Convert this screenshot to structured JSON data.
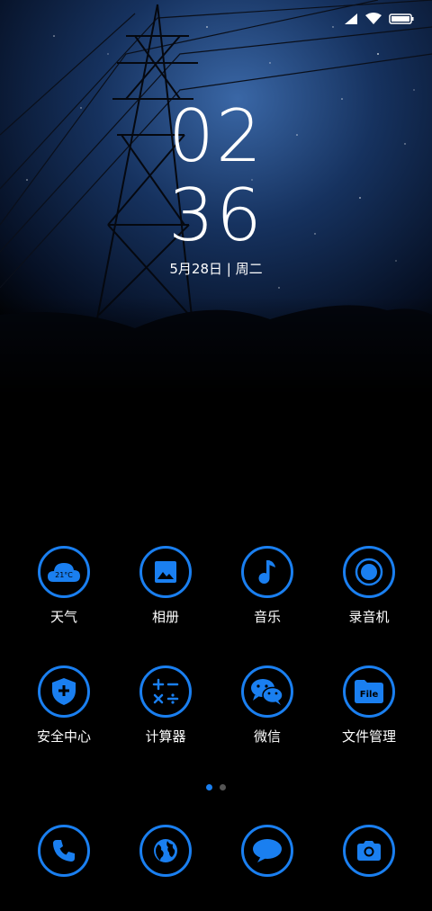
{
  "lockscreen": {
    "hour": "02",
    "minute": "36",
    "date": "5月28日 | 周二"
  },
  "status_bar": {
    "icons": [
      "signal-icon",
      "wifi-icon",
      "battery-icon"
    ]
  },
  "apps_row1": [
    {
      "label": "天气",
      "icon": "weather-icon",
      "temp": "21°C"
    },
    {
      "label": "相册",
      "icon": "gallery-icon"
    },
    {
      "label": "音乐",
      "icon": "music-icon"
    },
    {
      "label": "录音机",
      "icon": "recorder-icon"
    }
  ],
  "apps_row2": [
    {
      "label": "安全中心",
      "icon": "shield-icon"
    },
    {
      "label": "计算器",
      "icon": "calculator-icon"
    },
    {
      "label": "微信",
      "icon": "wechat-icon"
    },
    {
      "label": "文件管理",
      "icon": "file-icon",
      "badge": "File"
    }
  ],
  "page_indicator": {
    "pages": 2,
    "active": 1
  },
  "dock": [
    {
      "icon": "phone-icon"
    },
    {
      "icon": "browser-icon"
    },
    {
      "icon": "message-icon"
    },
    {
      "icon": "camera-icon"
    }
  ],
  "colors": {
    "accent": "#1a7ff0",
    "background": "#000000"
  }
}
